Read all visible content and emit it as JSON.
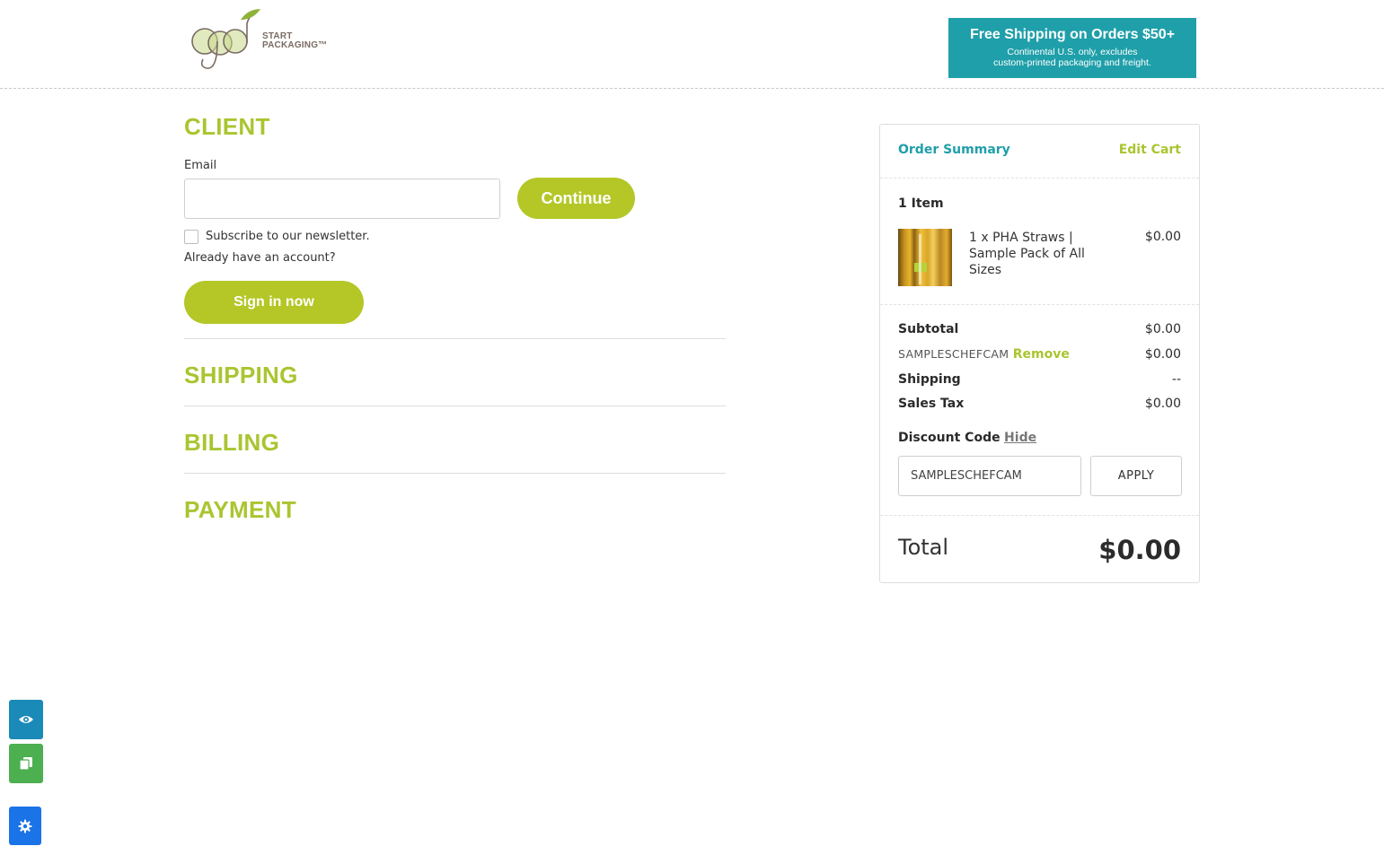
{
  "header": {
    "logo_word": "good",
    "logo_line1": "START",
    "logo_line2": "PACKAGING™",
    "promo_title": "Free Shipping on Orders $50+",
    "promo_line1": "Continental U.S. only, excludes",
    "promo_line2": "custom-printed packaging and freight."
  },
  "client": {
    "title": "CLIENT",
    "email_label": "Email",
    "email_value": "",
    "continue_label": "Continue",
    "newsletter_label": "Subscribe to our newsletter.",
    "newsletter_checked": false,
    "account_prompt": "Already have an account?",
    "signin_label": "Sign in now"
  },
  "sections": {
    "shipping": "SHIPPING",
    "billing": "BILLING",
    "payment": "PAYMENT"
  },
  "summary": {
    "title": "Order Summary",
    "edit_cart": "Edit Cart",
    "item_count": "1 Item",
    "item_line1": "1 x PHA Straws |",
    "item_line2": "Sample Pack of All",
    "item_line3": "Sizes",
    "item_price": "$0.00",
    "subtotal_label": "Subtotal",
    "subtotal_value": "$0.00",
    "coupon_code": "SAMPLESCHEFCAM",
    "coupon_remove": "Remove",
    "coupon_value": "$0.00",
    "shipping_label": "Shipping",
    "shipping_value": "--",
    "tax_label": "Sales Tax",
    "tax_value": "$0.00",
    "discount_label": "Discount Code",
    "discount_hide": "Hide",
    "discount_input_value": "SAMPLESCHEFCAM",
    "apply_label": "APPLY",
    "total_label": "Total",
    "total_value": "$0.00"
  },
  "colors": {
    "brand_green": "#b4c727",
    "brand_teal": "#1f9fa9",
    "accessibility_blue": "#1a8ab8",
    "copy_green": "#4caf50",
    "settings_blue": "#1b73e8"
  },
  "side_tools": [
    "eye-icon",
    "copy-icon",
    "gear-icon"
  ]
}
